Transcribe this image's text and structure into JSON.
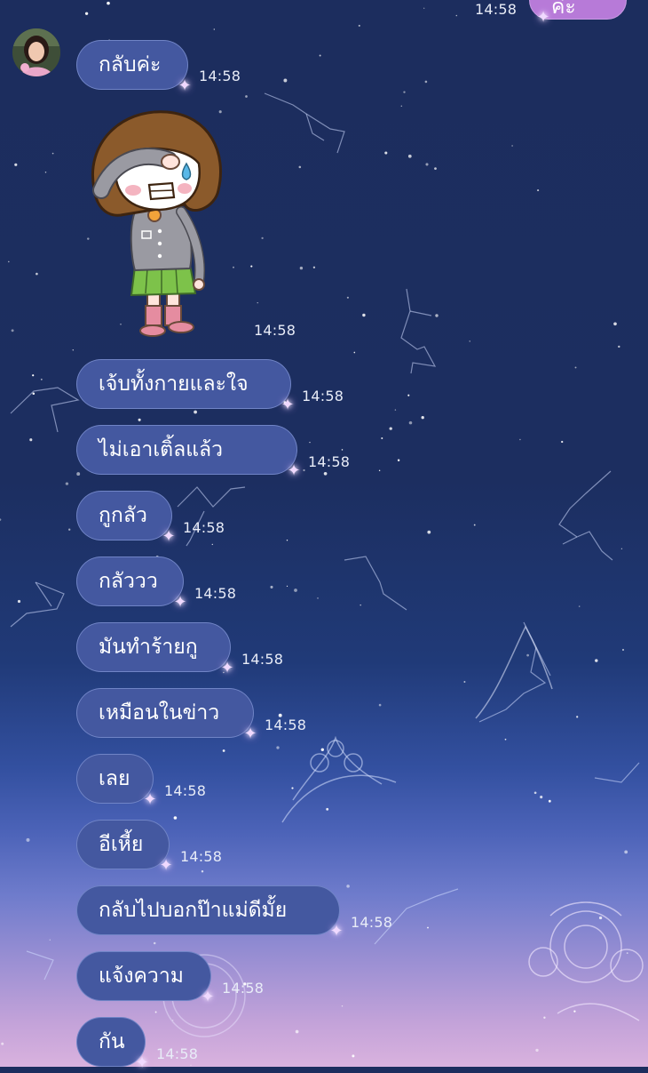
{
  "chat": {
    "outgoing": {
      "text": "ค่ะ",
      "time": "14:58"
    },
    "sticker_time": "14:58",
    "messages": [
      {
        "text": "กลับค่ะ",
        "time": "14:58"
      },
      {
        "text": "เจ้บทั้งกายและใจ",
        "time": "14:58"
      },
      {
        "text": "ไม่เอาเติ้ลแล้ว",
        "time": "14:58"
      },
      {
        "text": "กูกลัว",
        "time": "14:58"
      },
      {
        "text": "กลัววว",
        "time": "14:58"
      },
      {
        "text": "มันทำร้ายกู",
        "time": "14:58"
      },
      {
        "text": "เหมือนในข่าว",
        "time": "14:58"
      },
      {
        "text": "เลย",
        "time": "14:58"
      },
      {
        "text": "อีเหี้ย",
        "time": "14:58"
      },
      {
        "text": "กลับไปบอกป๊าแม่ดีมั้ย",
        "time": "14:58"
      },
      {
        "text": "แจ้งความ",
        "time": "14:58"
      },
      {
        "text": "กัน",
        "time": "14:58"
      }
    ]
  },
  "icons": {
    "sparkle": "sparkle-icon",
    "avatar": "avatar",
    "sticker": "crying-girl-sticker"
  },
  "colors": {
    "bubble_in": "#4458a0",
    "bubble_out": "#b77ad8",
    "timestamp": "#e8ecf7"
  }
}
